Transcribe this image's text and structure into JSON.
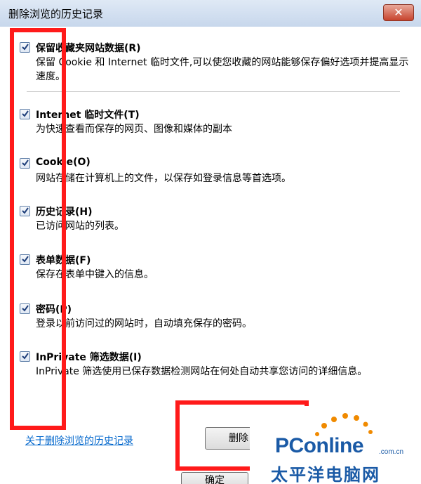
{
  "window": {
    "title": "删除浏览的历史记录",
    "close_label": "✕"
  },
  "options": [
    {
      "title": "保留收藏夹网站数据(R)",
      "description": "保留 Cookie 和 Internet 临时文件,可以使您收藏的网站能够保存偏好选项并提高显示速度。",
      "checked": true
    },
    {
      "title": "Internet 临时文件(T)",
      "description": "为快速查看而保存的网页、图像和媒体的副本",
      "checked": true
    },
    {
      "title": "Cookie(O)",
      "description": "网站存储在计算机上的文件，以保存如登录信息等首选项。",
      "checked": true
    },
    {
      "title": "历史记录(H)",
      "description": "已访问网站的列表。",
      "checked": true
    },
    {
      "title": "表单数据(F)",
      "description": "保存在表单中键入的信息。",
      "checked": true
    },
    {
      "title": "密码(P)",
      "description": "登录以前访问过的网站时，自动填充保存的密码。",
      "checked": true
    },
    {
      "title": "InPrivate 筛选数据(I)",
      "description": "InPrivate 筛选使用已保存数据检测网站在何处自动共享您访问的详细信息。",
      "checked": true
    }
  ],
  "footer": {
    "help_link": "关于删除浏览的历史记录",
    "delete_label": "删除",
    "ok_label": "确定"
  },
  "watermark": {
    "brand": "PConline",
    "domain": ".com.cn",
    "chinese": "太平洋电脑网"
  },
  "colors": {
    "accent": "#1a5aa6",
    "highlight": "#ff1a1a",
    "link": "#0066cc"
  }
}
